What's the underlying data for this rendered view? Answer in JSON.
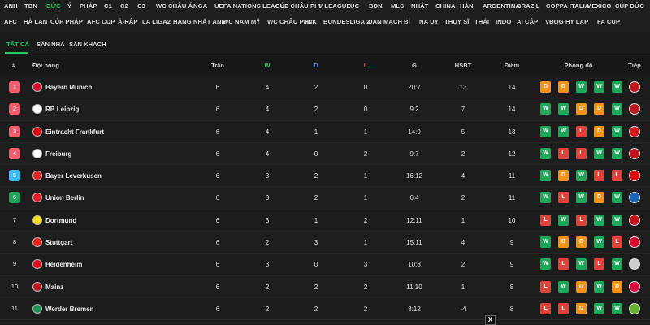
{
  "league_nav": {
    "row1": [
      "ANH",
      "TBN",
      "ĐỨC",
      "Ý",
      "PHÁP",
      "C1",
      "C2",
      "C3",
      "WC CHÂU Á",
      "NGA",
      "UEFA NATIONS LEAGUE",
      "CÚP CHÂU PHI",
      "V LEAGUE",
      "ÚC",
      "BĐN",
      "MLS",
      "NHẬT",
      "CHINA",
      "HÀN",
      "ARGENTINA",
      "BRAZIL",
      "COPPA ITALIA",
      "MEXICO",
      "CÚP ĐỨC"
    ],
    "row2": [
      "AFC",
      "HÀ LAN",
      "CÚP PHÁP",
      "AFC CUP",
      "Ả-RẬP",
      "LA LIGA2",
      "HẠNG NHẤT ANH",
      "WC NAM MỸ",
      "WC CHÂU PHI",
      "TNK",
      "BUNDESLIGA 2",
      "ĐAN MẠCH",
      "BỈ",
      "NA UY",
      "THỤY SĨ",
      "THÁI",
      "INDO",
      "AI CẬP",
      "VĐQG HY LẠP",
      "FA CUP"
    ],
    "active": "ĐỨC"
  },
  "tabs": [
    "TẤT CẢ",
    "SÂN NHÀ",
    "SÂN KHÁCH"
  ],
  "active_tab": "TẤT CẢ",
  "table": {
    "headers": {
      "rank": "#",
      "team": "Đội bóng",
      "played": "Trận",
      "won": "W",
      "drawn": "D",
      "lost": "L",
      "goals": "G",
      "gd": "HSBT",
      "points": "Điểm",
      "form": "Phong độ",
      "next": "Tiếp"
    },
    "rows": [
      {
        "rank": "1",
        "zone": "cl",
        "team": "Bayern Munich",
        "crest": "#dc052d",
        "played": "6",
        "won": "4",
        "drawn": "2",
        "lost": "0",
        "goals": "20:7",
        "gd": "13",
        "points": "14",
        "form": [
          "D",
          "D",
          "W",
          "W",
          "W"
        ],
        "next": "#c3141e"
      },
      {
        "rank": "2",
        "zone": "cl",
        "team": "RB Leipzig",
        "crest": "#ffffff",
        "played": "6",
        "won": "4",
        "drawn": "2",
        "lost": "0",
        "goals": "9:2",
        "gd": "7",
        "points": "14",
        "form": [
          "W",
          "W",
          "D",
          "D",
          "W"
        ],
        "next": "#c3141e"
      },
      {
        "rank": "3",
        "zone": "cl",
        "team": "Eintracht Frankfurt",
        "crest": "#e1000f",
        "played": "6",
        "won": "4",
        "drawn": "1",
        "lost": "1",
        "goals": "14:9",
        "gd": "5",
        "points": "13",
        "form": [
          "W",
          "W",
          "L",
          "D",
          "W"
        ],
        "next": "#d7191f"
      },
      {
        "rank": "4",
        "zone": "cl",
        "team": "Freiburg",
        "crest": "#ffffff",
        "played": "6",
        "won": "4",
        "drawn": "0",
        "lost": "2",
        "goals": "9:7",
        "gd": "2",
        "points": "12",
        "form": [
          "W",
          "L",
          "L",
          "W",
          "W"
        ],
        "next": "#c3141e"
      },
      {
        "rank": "5",
        "zone": "ecl",
        "team": "Bayer Leverkusen",
        "crest": "#e32221",
        "played": "6",
        "won": "3",
        "drawn": "2",
        "lost": "1",
        "goals": "16:12",
        "gd": "4",
        "points": "11",
        "form": [
          "W",
          "D",
          "W",
          "L",
          "L"
        ],
        "next": "#e1000f"
      },
      {
        "rank": "6",
        "zone": "conf",
        "team": "Union Berlin",
        "crest": "#eb1923",
        "played": "6",
        "won": "3",
        "drawn": "2",
        "lost": "1",
        "goals": "6:4",
        "gd": "2",
        "points": "11",
        "form": [
          "W",
          "L",
          "W",
          "D",
          "W"
        ],
        "next": "#1c63b7"
      },
      {
        "rank": "7",
        "zone": "plain",
        "team": "Dortmund",
        "crest": "#fde100",
        "played": "6",
        "won": "3",
        "drawn": "1",
        "lost": "2",
        "goals": "12:11",
        "gd": "1",
        "points": "10",
        "form": [
          "L",
          "W",
          "L",
          "W",
          "W"
        ],
        "next": "#c3141e"
      },
      {
        "rank": "8",
        "zone": "plain",
        "team": "Stuttgart",
        "crest": "#e32219",
        "played": "6",
        "won": "2",
        "drawn": "3",
        "lost": "1",
        "goals": "15:11",
        "gd": "4",
        "points": "9",
        "form": [
          "W",
          "D",
          "D",
          "W",
          "L"
        ],
        "next": "#dc052d"
      },
      {
        "rank": "9",
        "zone": "plain",
        "team": "Heidenheim",
        "crest": "#e2001a",
        "played": "6",
        "won": "3",
        "drawn": "0",
        "lost": "3",
        "goals": "10:8",
        "gd": "2",
        "points": "9",
        "form": [
          "W",
          "L",
          "W",
          "L",
          "W"
        ],
        "next": "#cccccc"
      },
      {
        "rank": "10",
        "zone": "plain",
        "team": "Mainz",
        "crest": "#c3141e",
        "played": "6",
        "won": "2",
        "drawn": "2",
        "lost": "2",
        "goals": "11:10",
        "gd": "1",
        "points": "8",
        "form": [
          "L",
          "W",
          "D",
          "W",
          "D"
        ],
        "next": "#dd0741"
      },
      {
        "rank": "11",
        "zone": "plain",
        "team": "Werder Bremen",
        "crest": "#1d9053",
        "played": "6",
        "won": "2",
        "drawn": "2",
        "lost": "2",
        "goals": "8:12",
        "gd": "-4",
        "points": "8",
        "form": [
          "L",
          "L",
          "D",
          "W",
          "W"
        ],
        "next": "#65b32e"
      }
    ]
  },
  "close_ad_label": "X"
}
